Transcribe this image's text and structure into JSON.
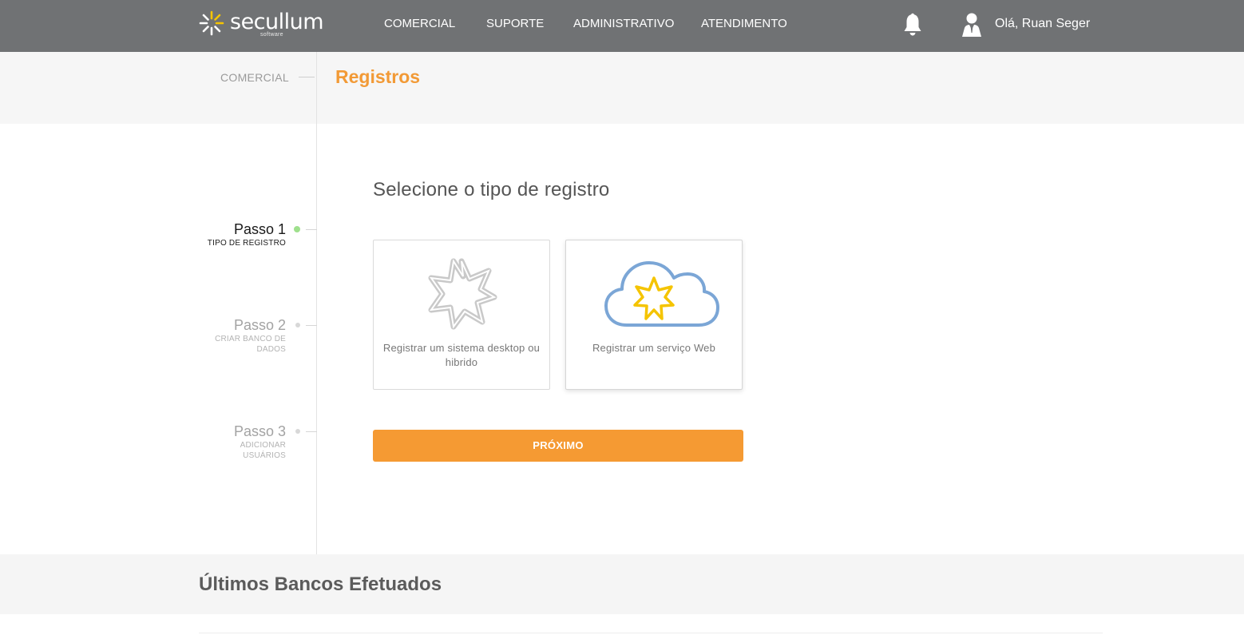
{
  "brand": {
    "name": "secullum",
    "sub": "software"
  },
  "nav": {
    "items": [
      {
        "label": "COMERCIAL"
      },
      {
        "label": "SUPORTE"
      },
      {
        "label": "ADMINISTRATIVO"
      },
      {
        "label": "ATENDIMENTO"
      }
    ],
    "notifications_icon": "bell-icon",
    "user_icon": "user-icon",
    "greeting": "Olá, Ruan Seger"
  },
  "breadcrumb": {
    "parent": "COMERCIAL",
    "title": "Registros"
  },
  "steps": [
    {
      "title": "Passo 1",
      "subtitle": "TIPO DE REGISTRO",
      "active": true
    },
    {
      "title": "Passo 2",
      "subtitle": "CRIAR BANCO DE DADOS",
      "active": false
    },
    {
      "title": "Passo 3",
      "subtitle": "ADICIONAR USUÁRIOS",
      "active": false
    }
  ],
  "main": {
    "heading": "Selecione o tipo de registro",
    "options": [
      {
        "label": "Registrar um sistema desktop ou hibrido",
        "icon": "secullum-star-icon",
        "selected": false
      },
      {
        "label": "Registrar um serviço Web",
        "icon": "cloud-star-icon",
        "selected": true
      }
    ],
    "next_label": "PRÓXIMO"
  },
  "recent": {
    "title": "Últimos Bancos Efetuados"
  },
  "colors": {
    "topbar": "#707274",
    "accent": "#f59a33",
    "title_orange": "#f29a36",
    "active_dot": "#9fe08d",
    "cloud_blue": "#7ba6d6",
    "star_yellow": "#f5c400"
  }
}
